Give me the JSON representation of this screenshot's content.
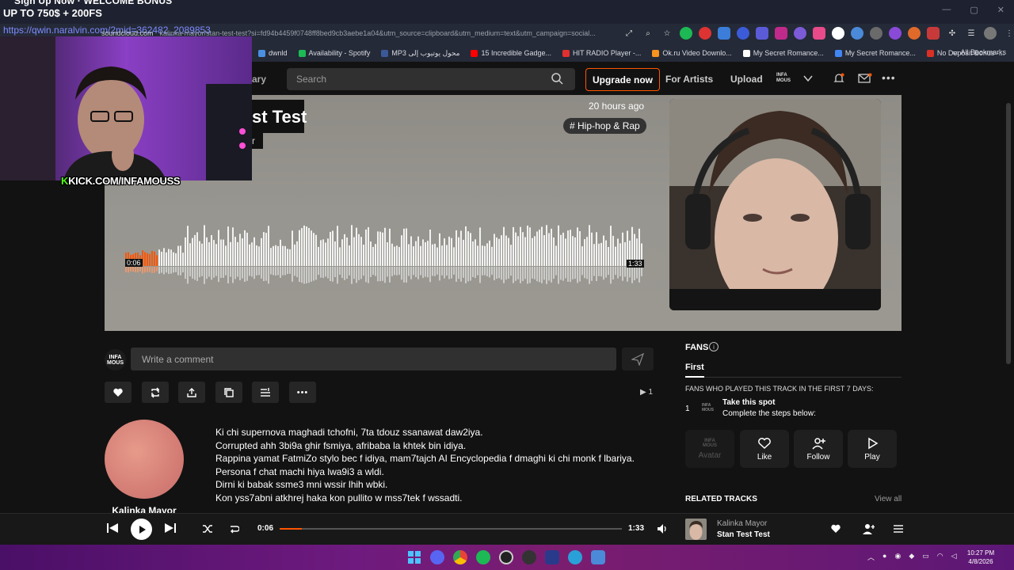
{
  "browser": {
    "promo_top": "Sign Up Now · WELCOME BONUS",
    "promo_text": "UP TO 750$ + 200FS",
    "url": "https://qwin.naralvin.com/2mid=362482_2089853",
    "url_host": "soundcloud.com",
    "url_rest": "kalinka-mayor/stan-test-test?si=fd94b4459f0748ff8bed9cb3aebe1a04&utm_source=clipboard&utm_medium=text&utm_campaign=social...",
    "window_controls": [
      "—",
      "▢",
      "✕"
    ],
    "bookmarks": [
      {
        "label": "dwnld",
        "color": "#4a90e2"
      },
      {
        "label": "Availability - Spotify",
        "color": "#1db954"
      },
      {
        "label": "MP3 محول يوتيوب إلى",
        "color": "#3b5998"
      },
      {
        "label": "15 Incredible Gadge...",
        "color": "#ff0000"
      },
      {
        "label": "HIT RADIO Player -...",
        "color": "#e03030"
      },
      {
        "label": "Ok.ru Video Downlo...",
        "color": "#f7931e"
      },
      {
        "label": "My Secret Romance...",
        "color": "#ffffff"
      },
      {
        "label": "My Secret Romance...",
        "color": "#4285f4"
      },
      {
        "label": "No Deposit Bonus -...",
        "color": "#d93025"
      }
    ],
    "all_bookmarks": "All Bookmarks"
  },
  "header": {
    "nav_library": "ary",
    "search_placeholder": "Search",
    "upgrade_label": "Upgrade now",
    "for_artists": "For Artists",
    "upload": "Upload",
    "avatar_text": "INFA MOUS"
  },
  "hero": {
    "title": "st Test",
    "artist_fragment": "r",
    "posted": "20 hours ago",
    "genre": "# Hip-hop & Rap",
    "waveform_elapsed": "0:06",
    "waveform_duration": "1:33",
    "progress_fraction": 0.065
  },
  "webcam": {
    "kick_prefix": "K",
    "kick_url": "KICK.COM/INFAMOUSS"
  },
  "comments": {
    "user_avatar_text": "INFA MOUS",
    "placeholder": "Write a comment"
  },
  "actions": {
    "plays_count": "1"
  },
  "artist": {
    "name": "Kalinka Mayor"
  },
  "description": [
    "Ki chi supernova maghadi tchofni, 7ta tdouz ssanawat daw2iya.",
    "Corrupted ahh 3bi9a ghir fsmiya, afribaba la khtek bin idiya.",
    "Rappina yamat FatmiZo stylo bec f idiya, mam7tajch AI Encyclopedia f dmaghi ki chi monk f lbariya.",
    "Persona f chat machi hiya lwa9i3 a wldi.",
    "Dirni ki babak ssme3 mni wssir lhih wbki.",
    "Kon yss7abni atkhrej haka kon pullito w mss7tek f wssadti."
  ],
  "fans": {
    "title": "FANS",
    "tab_first": "First",
    "subtitle": "FANS WHO PLAYED THIS TRACK IN THE FIRST 7 DAYS:",
    "rank": "1",
    "mini_avatar_text": "INFA MOUS",
    "take_spot": "Take this spot",
    "complete_steps": "Complete the steps below:",
    "btn_avatar": "Avatar",
    "btn_avatar_text": "INFA MOUS",
    "btn_like": "Like",
    "btn_follow": "Follow",
    "btn_play": "Play"
  },
  "related": {
    "title": "RELATED TRACKS",
    "view_all": "View all"
  },
  "player": {
    "elapsed": "0:06",
    "duration": "1:33",
    "progress_fraction": 0.065,
    "artist": "Kalinka Mayor",
    "title": "Stan Test Test"
  },
  "taskbar": {
    "time": "10:27 PM",
    "date": "4/8/2026"
  },
  "colors": {
    "accent": "#ff5500",
    "kick_green": "#53fc18",
    "url_blue": "#7d8bff"
  }
}
